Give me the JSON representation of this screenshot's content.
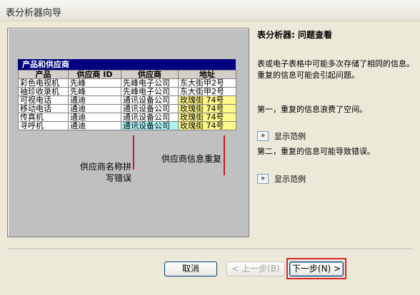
{
  "window": {
    "title": "表分析器向导"
  },
  "sample": {
    "heading": "产品和供应商",
    "columns": [
      "产品",
      "供应商 ID",
      "供应商",
      "地址"
    ],
    "rows": [
      [
        "彩色电视机",
        "先峰",
        "先峰电子公司",
        "东大街甲2号"
      ],
      [
        "袖珍收录机",
        "先峰",
        "先峰电子公司",
        "东大街甲2号"
      ],
      [
        "可视电话",
        "通迪",
        "通讯设备公司",
        "玫瑰街 74号"
      ],
      [
        "移动电话",
        "通迪",
        "通讯设备公司",
        "玫瑰街 74号"
      ],
      [
        "传真机",
        "通迪",
        "通讯设备公司",
        "玫瑰街 74号"
      ],
      [
        "寻呼机",
        "通迪",
        "通讯设备公司",
        "玫瑰街 74号"
      ]
    ]
  },
  "callouts": {
    "misspelled": [
      "供应商名称拼",
      "写错误"
    ],
    "duplicate": "供应商信息重复"
  },
  "right": {
    "title": "表分析器: 问题查看",
    "intro": "表或电子表格中可能多次存储了相同的信息。重复的信息可能会引起问题。",
    "point1": "第一，重复的信息浪费了空间。",
    "point2": "第二，重复的信息可能导致错误。",
    "show_example": "显示范例",
    "show_icon": "»"
  },
  "buttons": {
    "cancel": "取消",
    "back": "< 上一步(B)",
    "next": "下一步(N) >"
  },
  "colors": {
    "accent": "#000080",
    "callout": "#c41e1e"
  }
}
